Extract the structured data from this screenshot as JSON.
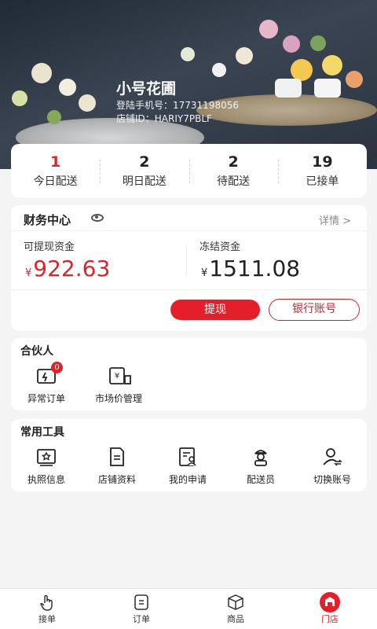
{
  "store": {
    "name": "小号花圃",
    "phone": "登陆手机号：17731198056",
    "id": "店铺ID：HARIY7PBLF"
  },
  "stats": [
    {
      "value": "1",
      "label": "今日配送"
    },
    {
      "value": "2",
      "label": "明日配送"
    },
    {
      "value": "2",
      "label": "待配送"
    },
    {
      "value": "19",
      "label": "已接单"
    }
  ],
  "finance": {
    "title": "财务中心",
    "detail": "详情 >",
    "available_label": "可提现资金",
    "available_currency": "¥",
    "available_value": "922.63",
    "frozen_label": "冻结资金",
    "frozen_currency": "¥",
    "frozen_value": "1511.08",
    "withdraw_button": "提现",
    "bank_button": "银行账号"
  },
  "partner": {
    "title": "合伙人",
    "items": [
      {
        "label": "异常订单",
        "icon": "abnormal-order-icon",
        "badge": "0"
      },
      {
        "label": "市场价管理",
        "icon": "market-price-icon"
      }
    ]
  },
  "tools": {
    "title": "常用工具",
    "items": [
      {
        "label": "执照信息",
        "icon": "license-icon"
      },
      {
        "label": "店铺资料",
        "icon": "store-info-icon"
      },
      {
        "label": "我的申请",
        "icon": "application-icon"
      },
      {
        "label": "配送员",
        "icon": "courier-icon"
      },
      {
        "label": "切换账号",
        "icon": "switch-account-icon"
      }
    ]
  },
  "tabbar": [
    {
      "label": "接单",
      "icon": "hand-tap-icon"
    },
    {
      "label": "订单",
      "icon": "order-icon"
    },
    {
      "label": "商品",
      "icon": "box-icon"
    },
    {
      "label": "门店",
      "icon": "store-icon"
    }
  ],
  "colors": {
    "accent": "#e41f2a",
    "background": "#f4f4f4"
  }
}
